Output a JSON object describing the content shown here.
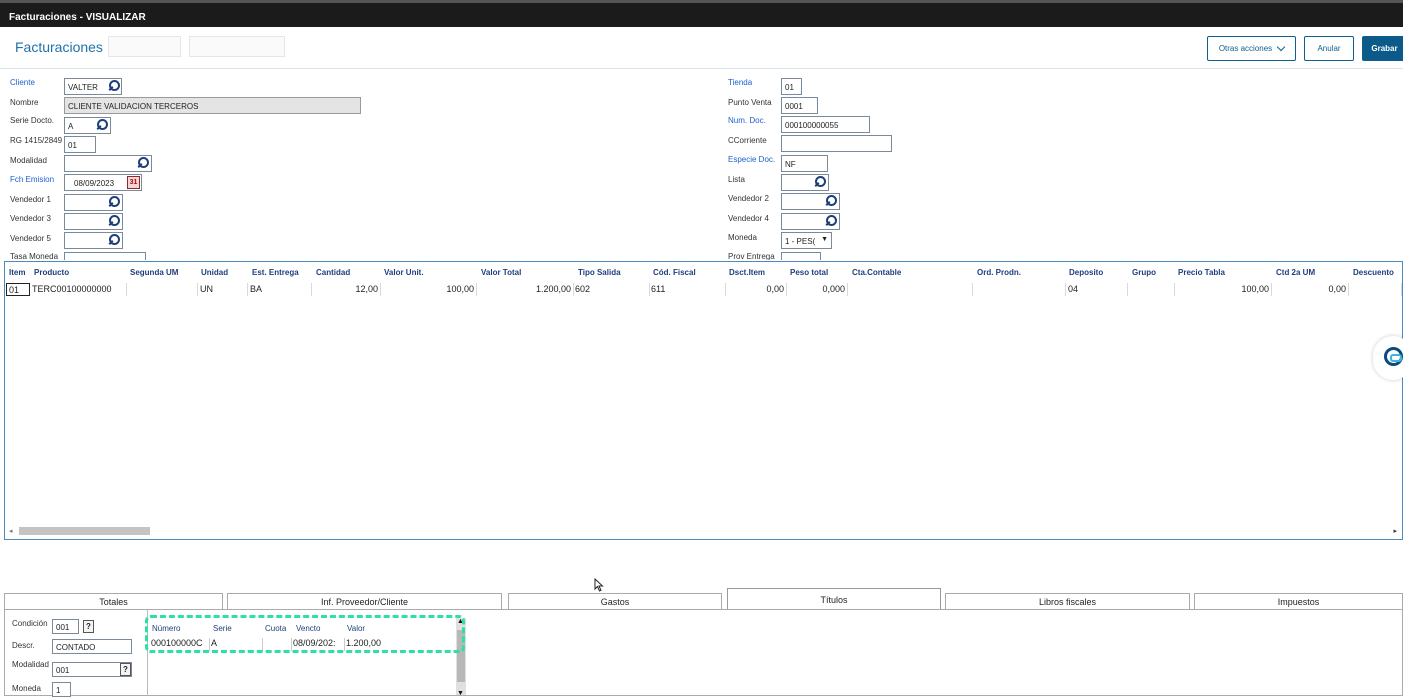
{
  "window": {
    "title": "Facturaciones - VISUALIZAR"
  },
  "header": {
    "title": "Facturaciones",
    "actions": {
      "otras": "Otras acciones",
      "anular": "Anular",
      "grabar": "Grabar"
    }
  },
  "form": {
    "cliente": {
      "label": "Cliente",
      "value": "VALTER"
    },
    "nombre": {
      "label": "Nombre",
      "value": "CLIENTE VALIDACION TERCEROS"
    },
    "serie": {
      "label": "Serie Docto.",
      "value": "A"
    },
    "rg": {
      "label": "RG 1415/2849",
      "value": "01"
    },
    "modalidad": {
      "label": "Modalidad",
      "value": ""
    },
    "fch": {
      "label": "Fch Emision",
      "value": "08/09/2023"
    },
    "vend1": {
      "label": "Vendedor 1",
      "value": ""
    },
    "vend3": {
      "label": "Vendedor 3",
      "value": ""
    },
    "vend5": {
      "label": "Vendedor 5",
      "value": ""
    },
    "tasa": {
      "label": "Tasa Moneda"
    },
    "tienda": {
      "label": "Tienda",
      "value": "01"
    },
    "punto": {
      "label": "Punto Venta",
      "value": "0001"
    },
    "numdoc": {
      "label": "Num. Doc.",
      "value": "000100000055"
    },
    "ccorriente": {
      "label": "CCorriente",
      "value": ""
    },
    "especie": {
      "label": "Especie Doc.",
      "value": "NF"
    },
    "lista": {
      "label": "Lista",
      "value": ""
    },
    "vend2": {
      "label": "Vendedor 2",
      "value": ""
    },
    "vend4": {
      "label": "Vendedor 4",
      "value": ""
    },
    "moneda": {
      "label": "Moneda",
      "value": "1 - PES("
    },
    "prov": {
      "label": "Prov Entrega"
    }
  },
  "grid": {
    "headers": [
      "Item",
      "Producto",
      "Segunda UM",
      "Unidad",
      "Est. Entrega",
      "Cantidad",
      "Valor Unit.",
      "Valor Total",
      "Tipo Salida",
      "Cód. Fiscal",
      "Dsct.Item",
      "Peso total",
      "Cta.Contable",
      "Ord. Prodn.",
      "Deposito",
      "Grupo",
      "Precio Tabla",
      "Ctd 2a UM",
      "Descuento"
    ],
    "row": {
      "item": "01",
      "producto": "TERC00100000000",
      "segunda": "",
      "unidad": "UN",
      "est": "BA",
      "cantidad": "12,00",
      "vunit": "100,00",
      "vtotal": "1.200,00",
      "tipo": "602",
      "cod": "611",
      "dsct": "0,00",
      "peso": "0,000",
      "cta": "",
      "ord": "",
      "deposito": "04",
      "grupo": "",
      "precio": "100,00",
      "ctd2": "0,00",
      "descuento": ""
    }
  },
  "tabs": [
    "Totales",
    "Inf. Proveedor/Cliente",
    "Gastos",
    "Títulos",
    "Libros fiscales",
    "Impuestos"
  ],
  "titulos": {
    "condicion": {
      "label": "Condición",
      "value": "001"
    },
    "descr": {
      "label": "Descr.",
      "value": "CONTADO"
    },
    "modalidad": {
      "label": "Modalidad",
      "value": "001"
    },
    "moneda": {
      "label": "Moneda",
      "value": "1"
    },
    "headers": [
      "Número",
      "Serie",
      "Cuota",
      "Vencto",
      "Valor"
    ],
    "row": {
      "numero": "000100000C",
      "serie": "A",
      "cuota": "",
      "vencto": "08/09/202:",
      "valor": "1.200,00"
    }
  },
  "colors": {
    "accent": "#0b5a8a",
    "highlight": "#2fe0a0",
    "label_blue": "#1e5fd0"
  }
}
